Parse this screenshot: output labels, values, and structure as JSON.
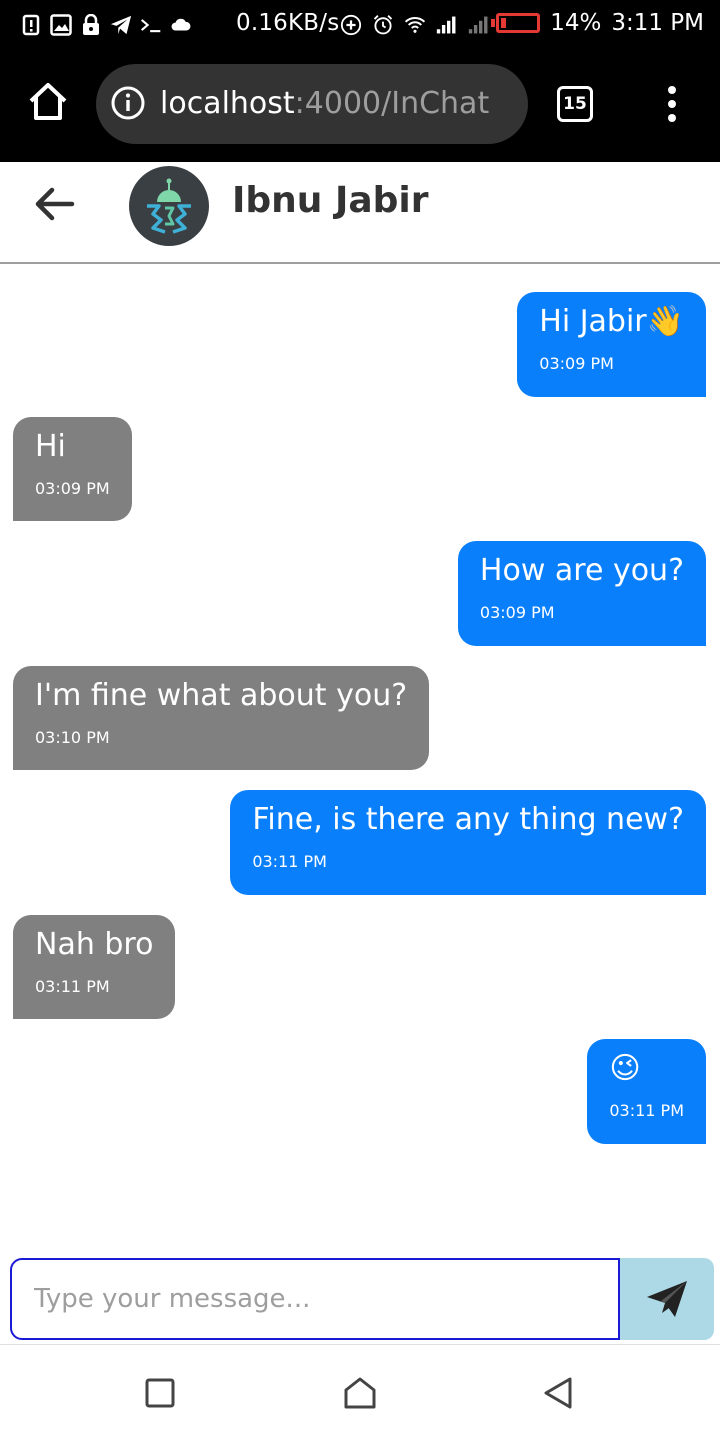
{
  "status_bar": {
    "net_speed": "0.16KB/s",
    "battery_percent": "14%",
    "battery_level": 0.14,
    "time": "3:11 PM",
    "battery_color": "#e53935"
  },
  "browser": {
    "url_host": "localhost",
    "url_path": ":4000/InChat",
    "tab_count": "15"
  },
  "chat": {
    "contact_name": "Ibnu Jabir",
    "messages": [
      {
        "direction": "sent",
        "text": "Hi Jabir👋",
        "time": "03:09 PM"
      },
      {
        "direction": "received",
        "text": "Hi",
        "time": "03:09 PM"
      },
      {
        "direction": "sent",
        "text": "How are you?",
        "time": "03:09 PM"
      },
      {
        "direction": "received",
        "text": "I'm fine what about you?",
        "time": "03:10 PM"
      },
      {
        "direction": "sent",
        "text": "Fine, is there any thing new?",
        "time": "03:11 PM"
      },
      {
        "direction": "received",
        "text": "Nah bro",
        "time": "03:11 PM"
      },
      {
        "direction": "sent",
        "text": "😉",
        "time": "03:11 PM"
      }
    ]
  },
  "composer": {
    "placeholder": "Type your message...",
    "value": ""
  },
  "colors": {
    "sent_bubble": "#0a7ffb",
    "received_bubble": "#808080",
    "send_button": "#add8e6",
    "input_border": "#1a1ad6"
  },
  "icons": {
    "home": "home-icon",
    "info": "info-icon",
    "menu": "more-vert-icon",
    "back": "arrow-left-icon",
    "send": "paper-plane-icon",
    "nav_recents": "square-icon",
    "nav_home": "home-outline-icon",
    "nav_back": "triangle-back-icon"
  }
}
